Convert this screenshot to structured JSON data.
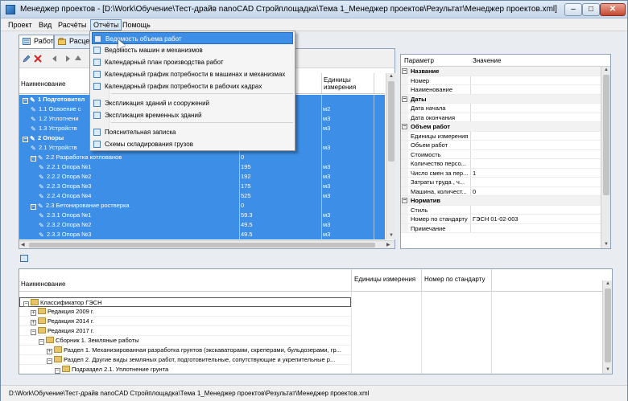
{
  "window": {
    "title": "Менеджер проектов - [D:\\Work\\Обучение\\Тест-драйв nanoCAD Стройплощадка\\Тема 1_Менеджер проектов\\Результат\\Менеджер проектов.xml]",
    "minimize_label": "–",
    "maximize_label": "□",
    "close_label": "✕"
  },
  "menu": [
    "Проект",
    "Вид",
    "Расчёты",
    "Отчёты",
    "Помощь"
  ],
  "tabs": [
    "Работы",
    "Расцен"
  ],
  "works_grid": {
    "headers": {
      "name": "Наименование",
      "units": "Единицы измерения"
    },
    "rows": [
      {
        "level": 0,
        "expander": "−",
        "name": "1 Подготовител",
        "value": "",
        "unit": ""
      },
      {
        "level": 1,
        "expander": "",
        "name": "1.1 Освоение с",
        "value": "",
        "unit": "м2"
      },
      {
        "level": 1,
        "expander": "",
        "name": "1.2 Уплотнени",
        "value": "",
        "unit": "м3"
      },
      {
        "level": 1,
        "expander": "",
        "name": "1.3 Устройств",
        "value": "",
        "unit": "м3"
      },
      {
        "level": 0,
        "expander": "−",
        "name": "2 Опоры",
        "value": "",
        "unit": ""
      },
      {
        "level": 1,
        "expander": "",
        "name": "2.1 Устройств",
        "value": "",
        "unit": "м3"
      },
      {
        "level": 1,
        "expander": "−",
        "name": "2.2 Разработка котлованов",
        "value": "0",
        "unit": ""
      },
      {
        "level": 2,
        "expander": "",
        "name": "2.2.1 Опора №1",
        "value": "195",
        "unit": "м3"
      },
      {
        "level": 2,
        "expander": "",
        "name": "2.2.2 Опора №2",
        "value": "192",
        "unit": "м3"
      },
      {
        "level": 2,
        "expander": "",
        "name": "2.2.3 Опора №3",
        "value": "175",
        "unit": "м3"
      },
      {
        "level": 2,
        "expander": "",
        "name": "2.2.4 Опора №4",
        "value": "525",
        "unit": "м3"
      },
      {
        "level": 1,
        "expander": "−",
        "name": "2.3 Бетонирование ростверка",
        "value": "0",
        "unit": ""
      },
      {
        "level": 2,
        "expander": "",
        "name": "2.3.1 Опора №1",
        "value": "59.3",
        "unit": "м3"
      },
      {
        "level": 2,
        "expander": "",
        "name": "2.3.2 Опора №2",
        "value": "49.5",
        "unit": "м3"
      },
      {
        "level": 2,
        "expander": "",
        "name": "2.3.3 Опора №3",
        "value": "49.5",
        "unit": "м3"
      }
    ]
  },
  "properties": {
    "headers": {
      "param": "Параметр",
      "value": "Значение"
    },
    "rows": [
      {
        "type": "cat",
        "key": "Название",
        "value": ""
      },
      {
        "type": "prop",
        "key": "Номер",
        "value": ""
      },
      {
        "type": "prop",
        "key": "Наименование",
        "value": ""
      },
      {
        "type": "cat",
        "key": "Даты",
        "value": ""
      },
      {
        "type": "prop",
        "key": "Дата начала",
        "value": ""
      },
      {
        "type": "prop",
        "key": "Дата окончания",
        "value": ""
      },
      {
        "type": "cat",
        "key": "Объем работ",
        "value": ""
      },
      {
        "type": "prop",
        "key": "Единицы измерения",
        "value": ""
      },
      {
        "type": "prop",
        "key": "Объем работ",
        "value": ""
      },
      {
        "type": "prop",
        "key": "Стоимость",
        "value": ""
      },
      {
        "type": "prop",
        "key": "Количество персо...",
        "value": ""
      },
      {
        "type": "prop",
        "key": "Число смен за пер...",
        "value": "1"
      },
      {
        "type": "prop",
        "key": "Затраты труда , ч...",
        "value": ""
      },
      {
        "type": "prop",
        "key": "Машина, количест...",
        "value": "0"
      },
      {
        "type": "cat",
        "key": "Норматив",
        "value": ""
      },
      {
        "type": "prop",
        "key": "Стиль",
        "value": ""
      },
      {
        "type": "prop",
        "key": "Номер по стандарту",
        "value": "ГЭСН 01-02-003"
      },
      {
        "type": "prop",
        "key": "Примечание",
        "value": ""
      }
    ]
  },
  "reports_menu": {
    "items": [
      "Ведомость объема работ",
      "Ведомость машин и механизмов",
      "Календарный план производства работ",
      "Календарный график потребности в машинах и механизмах",
      "Календарный график потребности в рабочих кадрах",
      "Экспликация зданий и сооружений",
      "Экспликация временных зданий",
      "Пояснительная записка",
      "Схемы складирования грузов"
    ]
  },
  "classifier": {
    "headers": {
      "name": "Наименование",
      "units": "Единицы измерения",
      "standard": "Номер по стандарту"
    },
    "rows": [
      {
        "level": 0,
        "expander": "−",
        "text": "Классификатор ГЭСН"
      },
      {
        "level": 1,
        "expander": "+",
        "text": "Редакция 2009 г."
      },
      {
        "level": 1,
        "expander": "+",
        "text": "Редакция 2014 г."
      },
      {
        "level": 1,
        "expander": "−",
        "text": "Редакция 2017 г."
      },
      {
        "level": 2,
        "expander": "−",
        "text": "Сборник 1. Земляные работы"
      },
      {
        "level": 3,
        "expander": "+",
        "text": "Раздел 1. Механизированная разработка грунтов (экскаваторами, скреперами, бульдозерами, гр..."
      },
      {
        "level": 3,
        "expander": "−",
        "text": "Раздел 2. Другие виды земляных работ, подготовительные, сопутствующие и укрепительные р..."
      },
      {
        "level": 4,
        "expander": "−",
        "text": "Подраздел 2.1. Уплотнение грунта"
      }
    ]
  },
  "statusbar": {
    "path": "D:\\Work\\Обучение\\Тест-драйв nanoCAD Стройплощадка\\Тема 1_Менеджер проектов\\Результат\\Менеджер проектов.xml"
  },
  "icons": {
    "toolbar": [
      "pencil-icon",
      "delete-icon",
      "arrow-left-icon",
      "arrow-right-icon",
      "arrow-up-icon"
    ],
    "tree_row": "pencil-icon",
    "classifier_row": "folder-icon"
  },
  "colors": {
    "selection": "#3d8ee6",
    "accent": "#2b6cb8"
  }
}
